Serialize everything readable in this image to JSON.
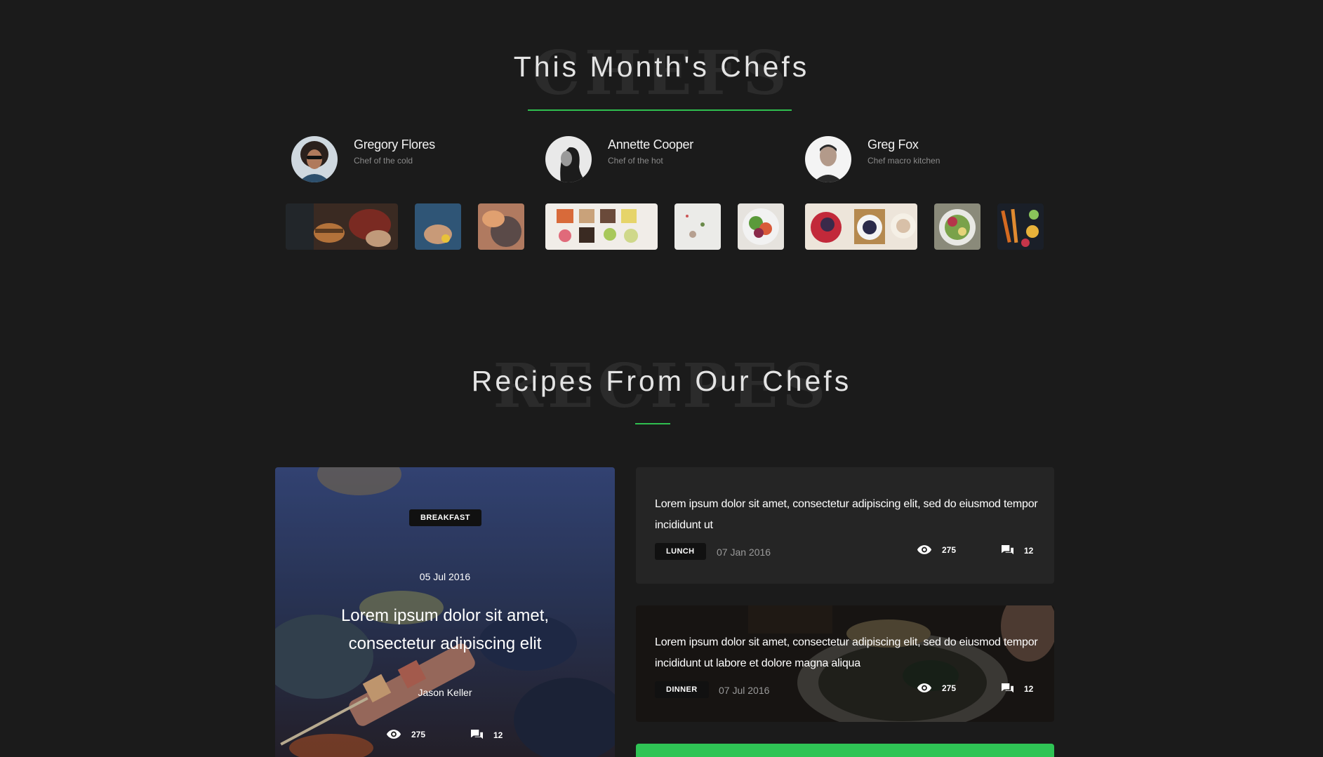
{
  "chefs_section": {
    "bg_word": "CHEFS",
    "title": "This Month's Chefs",
    "chefs": [
      {
        "name": "Gregory Flores",
        "role": "Chef of the cold"
      },
      {
        "name": "Annette Cooper",
        "role": "Chef of the hot"
      },
      {
        "name": "Greg Fox",
        "role": "Chef macro kitchen"
      }
    ]
  },
  "recipes_section": {
    "bg_word": "RECIPES",
    "title": "Recipes From Our Chefs"
  },
  "featured_recipe": {
    "category": "BREAKFAST",
    "date": "05 Jul 2016",
    "title": "Lorem ipsum dolor sit amet, consectetur adipiscing elit",
    "author": "Jason Keller",
    "views": "275",
    "comments": "12"
  },
  "recipes": [
    {
      "text": "Lorem ipsum dolor sit amet, consectetur adipiscing elit, sed do eiusmod tempor incididunt ut",
      "category": "LUNCH",
      "date": "07 Jan 2016",
      "views": "275",
      "comments": "12"
    },
    {
      "text": "Lorem ipsum dolor sit amet, consectetur adipiscing elit, sed do eiusmod tempor incididunt ut labore et dolore magna aliqua",
      "category": "DINNER",
      "date": "07 Jul 2016",
      "views": "275",
      "comments": "12"
    }
  ],
  "icons": {
    "views": "eye-icon",
    "comments": "comment-icon"
  },
  "colors": {
    "background": "#1b1b1b",
    "accent": "#2fc455",
    "card": "#252525"
  }
}
